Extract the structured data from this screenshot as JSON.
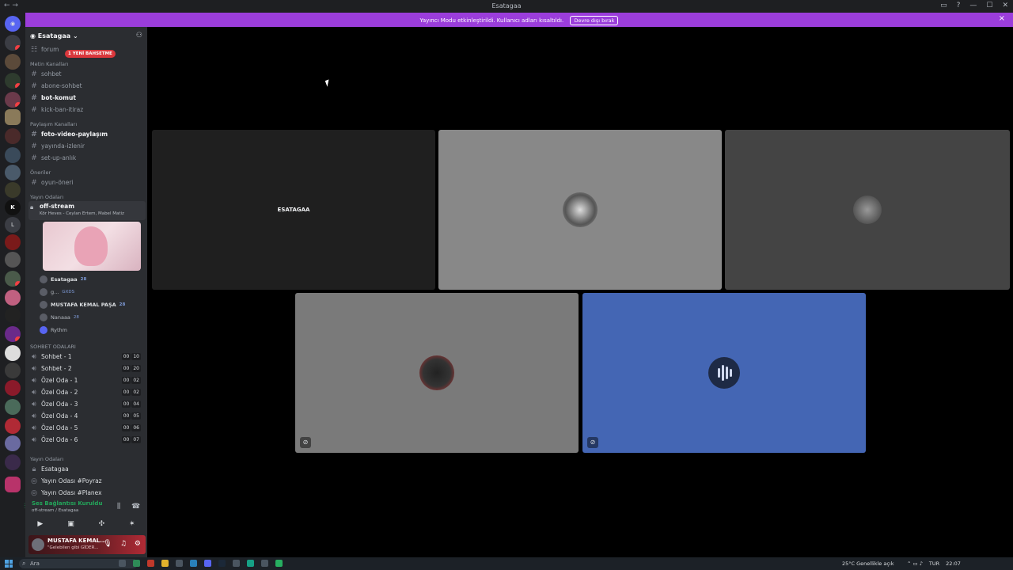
{
  "window": {
    "title": "Esatagaa"
  },
  "notice": {
    "message": "Yayıncı Modu etkinleştirildi. Kullanıcı adları kısaltıldı.",
    "button": "Devre dışı bırak"
  },
  "server": {
    "name": "Esatagaa"
  },
  "new_badge": "1 YENİ BAHSETME",
  "categories": {
    "text": "Metin Kanalları",
    "share": "Paylaşım Kanalları",
    "suggestions": "Öneriler",
    "streams": "Yayın Odaları",
    "chat_rooms": "SOHBET ODALARI",
    "streams2": "Yayın Odaları"
  },
  "channels": {
    "forum": "forum",
    "sohbet": "sohbet",
    "abone": "abone-sohbet",
    "bot": "bot-komut",
    "kick": "kick-ban-itiraz",
    "foto": "foto-video-paylaşım",
    "yayinda": "yayında-izlenir",
    "setup": "set-up-anlık",
    "oyun": "oyun-öneri"
  },
  "live": {
    "name": "off-stream",
    "activity": "Kör Heves - Ceylan Ertem, Mabel Matiz"
  },
  "voice_users": [
    {
      "name": "Esatagaa",
      "tag": "28"
    },
    {
      "name": "g...",
      "tag": "GXDS"
    },
    {
      "name": "MUSTAFA KEMAL PAŞA",
      "tag": "28"
    },
    {
      "name": "Nanaaa",
      "tag": "28"
    },
    {
      "name": "Rythm",
      "tag": ""
    }
  ],
  "chat_rooms": [
    {
      "name": "Sohbet - 1",
      "a": "00",
      "b": "10"
    },
    {
      "name": "Sohbet - 2",
      "a": "00",
      "b": "20"
    },
    {
      "name": "Özel Oda - 1",
      "a": "00",
      "b": "02"
    },
    {
      "name": "Özel Oda - 2",
      "a": "00",
      "b": "02"
    },
    {
      "name": "Özel Oda - 3",
      "a": "00",
      "b": "04"
    },
    {
      "name": "Özel Oda - 4",
      "a": "00",
      "b": "05"
    },
    {
      "name": "Özel Oda - 5",
      "a": "00",
      "b": "06"
    },
    {
      "name": "Özel Oda - 6",
      "a": "00",
      "b": "07"
    }
  ],
  "stream_rooms": [
    "Esatagaa",
    "Yayın Odası #Poyraz",
    "Yayın Odası #Planex"
  ],
  "voice_status": {
    "title": "Ses Bağlantısı Kuruldu",
    "channel": "off-stream / Esatagaa"
  },
  "user": {
    "name": "MUSTAFA KEMAL...",
    "status": "\"Gelebilen gibi GİDER..."
  },
  "tiles": {
    "esatagaa": "ESATAGAA"
  },
  "taskbar": {
    "search": "Ara",
    "weather": "25°C Genellikle açık",
    "lang": "TUR",
    "time": "22:07"
  },
  "colors": {
    "accent": "#9b3ddb",
    "blurple_tile": "#4466b4",
    "online": "#23a55a",
    "danger": "#da373c"
  }
}
